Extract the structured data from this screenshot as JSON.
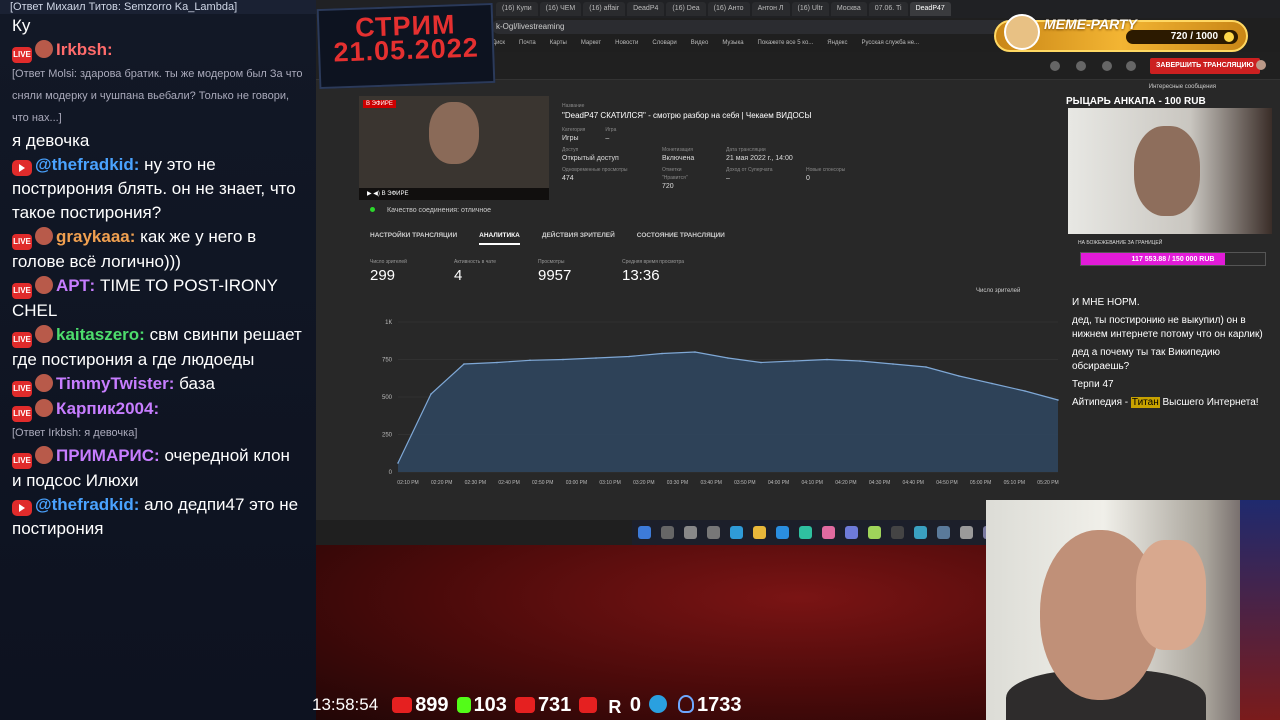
{
  "chat": {
    "top_reply": "[Ответ Михаил Титов: Semzorro Ka_Lambda]",
    "messages": [
      {
        "type": "plain",
        "text": "Ку"
      },
      {
        "type": "live",
        "nick": "Irkbsh:",
        "nick_color": "#ff6b6b",
        "text": ""
      },
      {
        "type": "reply",
        "text": "[Ответ Molsi: здарова братик. ты же модером был За что сняли модерку и чушпана вьебали? Только не говори, что нах...]"
      },
      {
        "type": "plain",
        "text": "я девочка"
      },
      {
        "type": "yt",
        "nick": "@thefradkid:",
        "nick_color": "#4aa3ff",
        "text": "ну это не пострирония блять. он не знает, что такое постирония?"
      },
      {
        "type": "live",
        "nick": "graykaaa:",
        "nick_color": "#f0a050",
        "text": "как же у него в голове всё логично)))"
      },
      {
        "type": "live",
        "nick": "АРТ:",
        "nick_color": "#c77dff",
        "text": "TIME TO POST-IRONY CHEL"
      },
      {
        "type": "live",
        "nick": "kaitaszero:",
        "nick_color": "#4ddc6c",
        "text": "свм свинпи решает где постирония а где людоеды"
      },
      {
        "type": "live",
        "nick": "TimmyTwister:",
        "nick_color": "#c77dff",
        "text": "база"
      },
      {
        "type": "live",
        "nick": "Карпик2004:",
        "nick_color": "#c77dff",
        "text": ""
      },
      {
        "type": "reply",
        "text": "[Ответ Irkbsh: я девочка]"
      },
      {
        "type": "live",
        "nick": "ПРИМАРИС:",
        "nick_color": "#c77dff",
        "text": "очередной клон и подсос Илюхи"
      },
      {
        "type": "yt",
        "nick": "@thefradkid:",
        "nick_color": "#4aa3ff",
        "text": "ало дедпи47 это не постирония"
      }
    ]
  },
  "stream_date": "СТРИМ 21.05.2022",
  "browser": {
    "tabs": [
      "(16) Купи",
      "(16) ЧЕМ",
      "(16) affair",
      "DeadP4",
      "(16) Dea",
      "(16) Анто",
      "Антон Л",
      "(16) Ultr",
      "Москва",
      "07.06. Ti",
      "DeadP47"
    ],
    "url": "k-Ogl/livestreaming",
    "bookmarks": [
      "Диск",
      "Почта",
      "Карты",
      "Маркет",
      "Новости",
      "Словари",
      "Видео",
      "Музыка",
      "Покажете все 5 ко...",
      "Яндекс",
      "Русская служба не..."
    ],
    "end_button": "ЗАВЕРШИТЬ ТРАНСЛЯЦИЮ"
  },
  "studio": {
    "preview_live": "В ЭФИРЕ",
    "preview_bar": "В ЭФИРЕ",
    "labels": {
      "name": "Название",
      "category": "Категория",
      "game": "Игра",
      "access": "Доступ",
      "monet": "Монетизация",
      "date": "Дата трансляции",
      "viewers": "Одновременные просмотры",
      "likes": "Отметки \"Нравится\"",
      "super": "Доход от Суперчата",
      "sponsors": "Новые спонсоры"
    },
    "title": "\"DeadP47 СКАТИЛСЯ\" - смотрю разбор на себя | Чекаем ВИДОСЫ",
    "category": "Игры",
    "game": "–",
    "access": "Открытый доступ",
    "monetization": "Включена",
    "date": "21 мая 2022 г., 14:00",
    "concurrent": "474",
    "likes": "720",
    "superchat": "–",
    "sponsors": "0",
    "connection": "Качество соединения: отличное",
    "tabs": [
      "НАСТРОЙКИ ТРАНСЛЯЦИИ",
      "АНАЛИТИКА",
      "ДЕЙСТВИЯ ЗРИТЕЛЕЙ",
      "СОСТОЯНИЕ ТРАНСЛЯЦИИ"
    ],
    "stats": [
      {
        "label": "Число зрителей",
        "value": "299"
      },
      {
        "label": "Активность в чате",
        "value": "4"
      },
      {
        "label": "Просмотры",
        "value": "9957"
      },
      {
        "label": "Средняя время просмотра",
        "value": "13:36"
      }
    ],
    "chart_selector": "Число зрителей"
  },
  "chart_data": {
    "type": "area",
    "ylim": [
      0,
      1000
    ],
    "yticks": [
      "1К",
      "750",
      "500",
      "250",
      "0"
    ],
    "x": [
      "02:10 PM",
      "02:20 PM",
      "02:30 PM",
      "02:40 PM",
      "02:50 PM",
      "03:00 PM",
      "03:10 PM",
      "03:20 PM",
      "03:30 PM",
      "03:40 PM",
      "03:50 PM",
      "04:00 PM",
      "04:10 PM",
      "04:20 PM",
      "04:30 PM",
      "04:40 PM",
      "04:50 PM",
      "05:00 PM",
      "05:10 PM",
      "05:20 PM"
    ],
    "values": [
      60,
      520,
      720,
      730,
      745,
      750,
      760,
      770,
      790,
      800,
      760,
      730,
      740,
      750,
      740,
      720,
      700,
      640,
      590,
      540,
      480
    ],
    "color": "#7fa8d6"
  },
  "taskbar": {
    "icons": [
      "windows-icon",
      "search-icon",
      "cortana-icon",
      "taskview-icon",
      "edge-icon",
      "explorer-icon",
      "mail-icon",
      "store-icon",
      "app-icon",
      "app-icon",
      "app-icon",
      "app-icon",
      "app-icon",
      "app-icon",
      "app-icon",
      "app-icon",
      "photoshop-icon",
      "app-icon",
      "chrome-icon"
    ]
  },
  "side": {
    "header": "Интересные сообщения",
    "raider": "РЫЦАРЬ АНКАПА - 100 RUB",
    "goal_label": "НА БОЖЕЖЕВАНИЕ ЗА ГРАНИЦЕЙ",
    "goal_text": "117 553.88 / 150 000 RUB",
    "goal_fraction": 0.7837,
    "messages": [
      {
        "text": "И МНЕ НОРМ."
      },
      {
        "text": "дед, ты постиронию не выкупил) он в нижнем интернете потому что он карлик)"
      },
      {
        "text": "дед а почему ты так Википедию обсираешь?"
      },
      {
        "text": "Терпи 47"
      },
      {
        "text_a": "Айтипедия - ",
        "hl": "Титан",
        "text_b": " Высшего Интернета!"
      }
    ]
  },
  "meme": {
    "title": "MEME-PARTY",
    "progress": "720 / 1000",
    "level": 0.72
  },
  "bottom": {
    "clock": "13:58:54",
    "youtube": "899",
    "kick": "103",
    "live": "731",
    "play": "",
    "r": "0",
    "telegram": "",
    "viewers": "1733"
  }
}
